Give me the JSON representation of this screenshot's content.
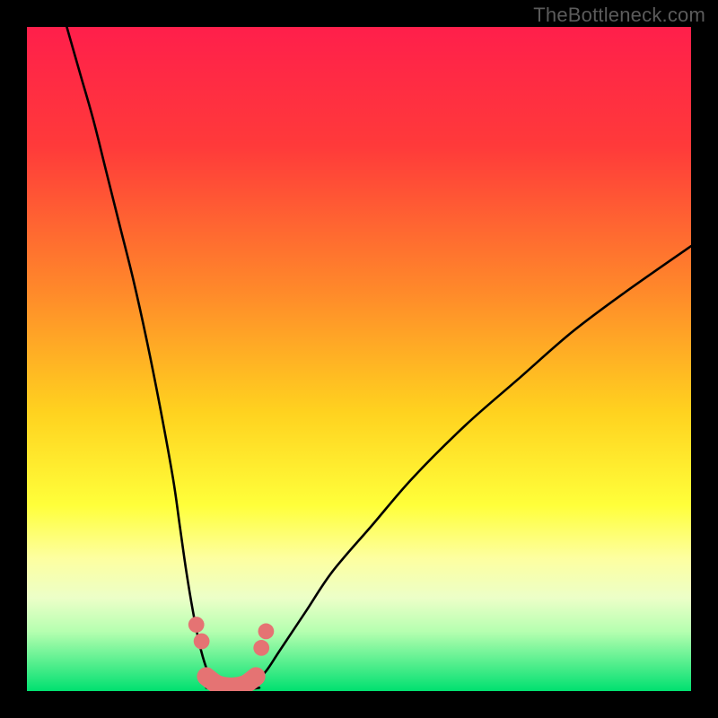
{
  "watermark": {
    "text": "TheBottleneck.com"
  },
  "chart_data": {
    "type": "line",
    "title": "",
    "xlabel": "",
    "ylabel": "",
    "xlim": [
      0,
      100
    ],
    "ylim": [
      0,
      100
    ],
    "grid": false,
    "legend": false,
    "background_gradient_stops": [
      {
        "pct": 0,
        "color": "#ff1f4b"
      },
      {
        "pct": 18,
        "color": "#ff3a3a"
      },
      {
        "pct": 40,
        "color": "#ff8a2a"
      },
      {
        "pct": 58,
        "color": "#ffd21f"
      },
      {
        "pct": 72,
        "color": "#ffff3a"
      },
      {
        "pct": 80,
        "color": "#fdffa0"
      },
      {
        "pct": 86,
        "color": "#ecffc8"
      },
      {
        "pct": 91,
        "color": "#b6ffb0"
      },
      {
        "pct": 100,
        "color": "#00e070"
      }
    ],
    "series": [
      {
        "name": "left-branch",
        "x": [
          6,
          8,
          10,
          12,
          14,
          16,
          18,
          20,
          22,
          23,
          24,
          25,
          26,
          27,
          28,
          29
        ],
        "y": [
          100,
          93,
          86,
          78,
          70,
          62,
          53,
          43,
          32,
          25,
          18,
          12,
          7,
          3.5,
          1.2,
          0.5
        ]
      },
      {
        "name": "right-branch",
        "x": [
          33,
          34,
          36,
          38,
          42,
          46,
          52,
          58,
          66,
          74,
          82,
          90,
          100
        ],
        "y": [
          0.5,
          1.0,
          3,
          6,
          12,
          18,
          25,
          32,
          40,
          47,
          54,
          60,
          67
        ]
      },
      {
        "name": "valley-floor",
        "x": [
          27,
          29,
          31,
          33,
          35
        ],
        "y": [
          0.5,
          0.2,
          0.15,
          0.2,
          0.5
        ]
      }
    ],
    "markers": [
      {
        "name": "left-upper",
        "x": 25.5,
        "y": 10,
        "r": 1.2,
        "color": "#e57373"
      },
      {
        "name": "left-lower",
        "x": 26.3,
        "y": 7.5,
        "r": 1.2,
        "color": "#e57373"
      },
      {
        "name": "right-upper",
        "x": 36.0,
        "y": 9,
        "r": 1.2,
        "color": "#e57373"
      },
      {
        "name": "right-lower",
        "x": 35.3,
        "y": 6.5,
        "r": 1.2,
        "color": "#e57373"
      }
    ],
    "valley_segment": {
      "x": [
        27,
        28.5,
        30,
        31.5,
        33,
        34.5
      ],
      "y": [
        2.2,
        1.1,
        0.7,
        0.7,
        1.1,
        2.2
      ],
      "color": "#e57373",
      "width": 2.8
    }
  }
}
